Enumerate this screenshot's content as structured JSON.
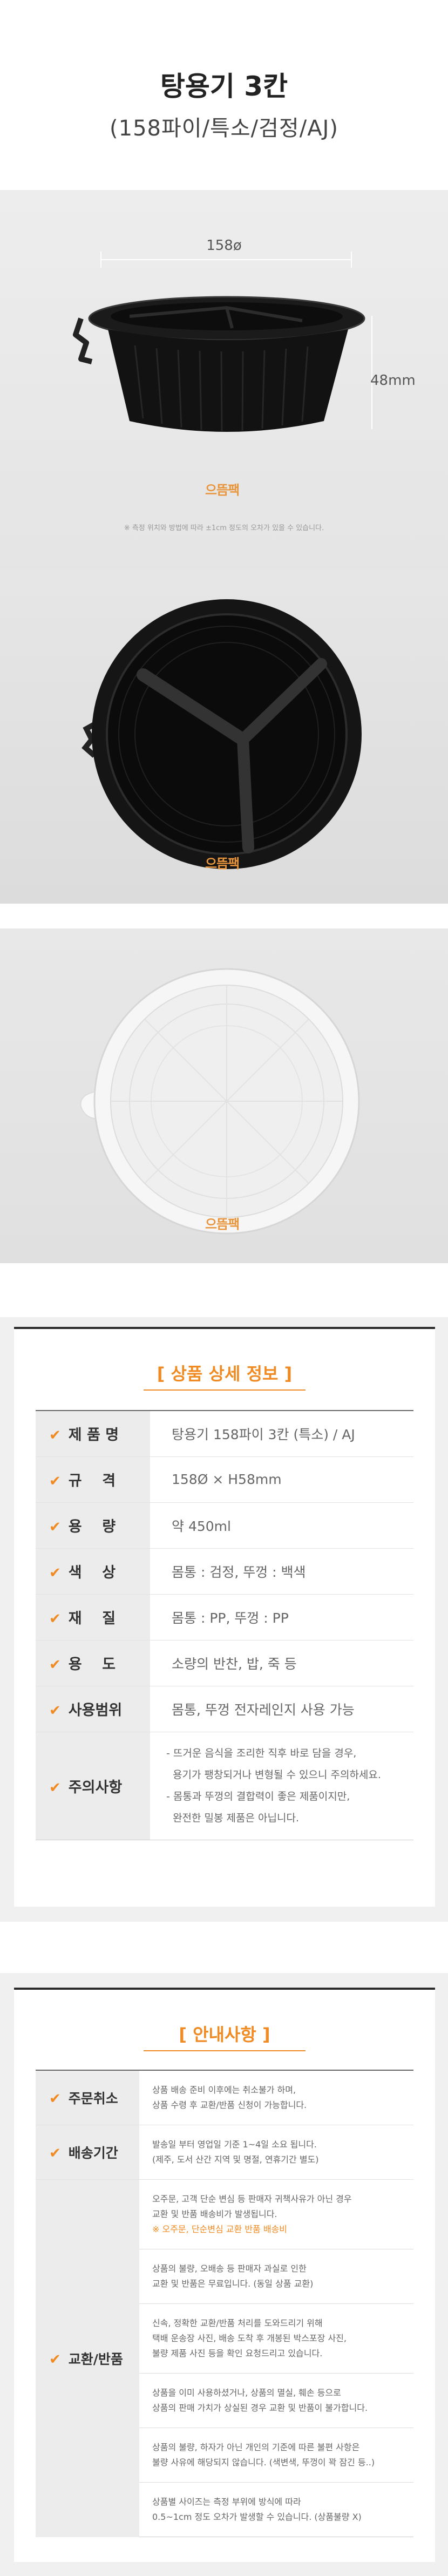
{
  "header": {
    "title": "탕용기 3칸",
    "subtitle": "(158파이/특소/검정/AJ)"
  },
  "photo1": {
    "width_label": "158ø",
    "height_label": "48mm",
    "logo": "으뜸팩",
    "note": "※ 측정 위치와 방법에 따라 ±1cm 정도의 오차가 있을 수 있습니다."
  },
  "photo2": {
    "logo": "으뜸팩"
  },
  "photo3": {
    "logo": "으뜸팩"
  },
  "spec": {
    "heading": "[ 상품 상세 정보 ]",
    "rows": [
      {
        "label": "제 품 명",
        "value": "탕용기 158파이 3칸 (특소) / AJ"
      },
      {
        "label": "규    격",
        "value": "158Ø × H58mm"
      },
      {
        "label": "용    량",
        "value": "약 450ml"
      },
      {
        "label": "색    상",
        "value": "몸통 : 검정,  뚜껑 : 백색"
      },
      {
        "label": "재    질",
        "value": "몸통 : PP,  뚜껑 : PP"
      },
      {
        "label": "용    도",
        "value": "소량의 반찬, 밥, 죽 등"
      },
      {
        "label": "사용범위",
        "value": "몸통, 뚜껑 전자레인지 사용 가능"
      },
      {
        "label": "주의사항",
        "value_lines": [
          "- 뜨거운 음식을 조리한 직후 바로 담을 경우,",
          "  용기가 팽창되거나 변형될 수 있으니 주의하세요.",
          "- 몸통과 뚜껑의 결합력이 좋은 제품이지만,",
          "  완전한 밀봉 제품은 아닙니다."
        ]
      }
    ]
  },
  "guide": {
    "heading": "[ 안내사항 ]",
    "cancel": {
      "label": "주문취소",
      "lines": [
        "상품 배송 준비 이후에는 취소불가 하며,",
        "상품 수령 후 교환/반품 신청이 가능합니다."
      ]
    },
    "shipping": {
      "label": "배송기간",
      "lines": [
        "발송일 부터 영업일 기준 1~4일 소요 됩니다.",
        "(제주, 도서 산간 지역 및 명절, 연휴기간 별도)"
      ]
    },
    "return": {
      "label": "교환/반품",
      "blocks": [
        {
          "lines": [
            "오주문, 고객 단순 변심 등 판매자 귀책사유가 아닌 경우",
            "교환 및 반품 배송비가 발생됩니다.",
            "※ 오주문, 단순변심 교환 반품 배송비"
          ]
        },
        {
          "lines": [
            "상품의 불량, 오배송 등 판매자 과실로 인한",
            "교환 및 반품은 무료입니다. (동일 상품 교환)"
          ]
        },
        {
          "lines": [
            "신속, 정확한 교환/반품 처리를 도와드리기 위해",
            "택배 운송장 사진, 배송 도착 후 개봉된 박스포장 사진,",
            "불량 제품 사진 등을 확인 요청드리고 있습니다."
          ]
        },
        {
          "lines": [
            "상품을 이미 사용하셨거나, 상품의 멸실, 훼손 등으로",
            "상품의 판매 가치가 상실된 경우 교환 및 반품이 불가합니다."
          ]
        },
        {
          "lines": [
            "상품의 불량, 하자가 아닌 개인의 기준에 따른 불편 사항은",
            "불량 사유에 해당되지 않습니다. (색변색, 뚜껑이 꽉 잠긴 등..)"
          ]
        },
        {
          "lines": [
            "상품별 사이즈는 측정 부위에 방식에 따라",
            "0.5~1cm 정도 오차가 발생할 수 있습니다. (상품불량 X)"
          ]
        }
      ]
    }
  },
  "colors": {
    "accent": "#f08a22",
    "container": "#111111",
    "lid": "#f4f4f4"
  }
}
